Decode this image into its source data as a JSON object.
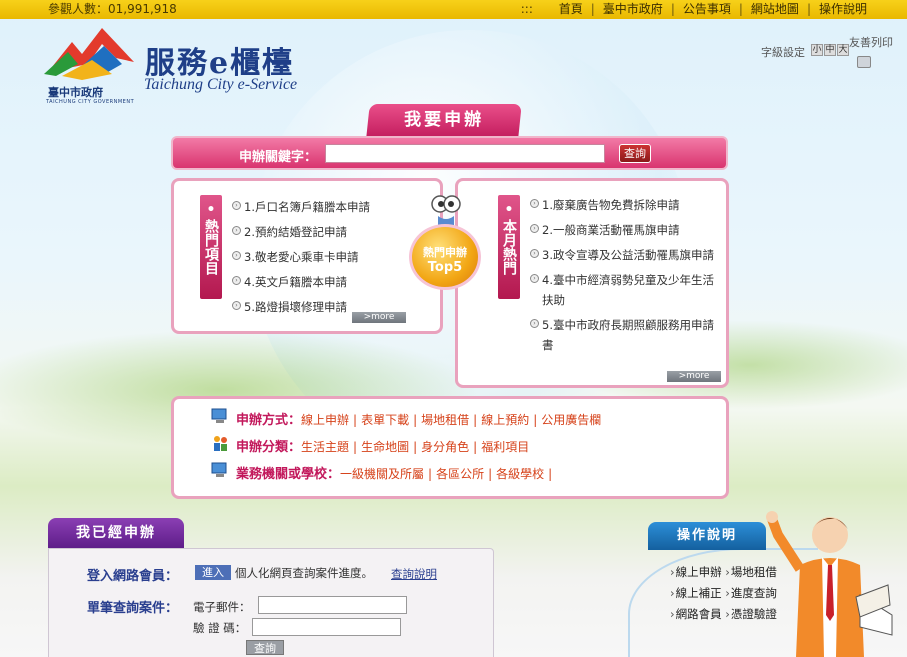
{
  "topbar": {
    "counter_label": "參觀人數：01,991,918",
    "nav_prefix": ":::",
    "nav": [
      "首頁",
      "臺中市政府",
      "公告事項",
      "網站地圖",
      "操作說明"
    ]
  },
  "logo": {
    "emblem_zh": "臺中市政府",
    "emblem_en": "TAICHUNG CITY GOVERNMENT",
    "title": "服務e櫃檯",
    "subtitle": "Taichung City e-Service"
  },
  "tools": {
    "font_label": "字級設定",
    "font_sizes": [
      "小",
      "中",
      "大"
    ],
    "print_label": "友善列印"
  },
  "apply": {
    "tab_label": "我要申辦",
    "search_label": "申辦關鍵字：",
    "search_value": "",
    "search_button": "查詢"
  },
  "hot": {
    "tab_label": "熱門項目",
    "items": [
      "1.戶口名簿戶籍謄本申請",
      "2.預約結婚登記申請",
      "3.敬老愛心乘車卡申請",
      "4.英文戶籍謄本申請",
      "5.路燈損壞修理申請"
    ],
    "more": ">more"
  },
  "monthly": {
    "tab_label": "本月熱門",
    "items": [
      "1.廢棄廣告物免費拆除申請",
      "2.一般商業活動罹馬旗申請",
      "3.政令宣導及公益活動罹馬旗申請",
      "4.臺中市經濟弱勢兒童及少年生活扶助",
      "5.臺中市政府長期照顧服務用申請書"
    ],
    "more": ">more"
  },
  "top5": {
    "line1": "熱門申辦",
    "line2": "Top5"
  },
  "methods": {
    "row1": {
      "head": "申辦方式：",
      "links": [
        "線上申辦",
        "表單下載",
        "場地租借",
        "線上預約",
        "公用廣告欄"
      ]
    },
    "row2": {
      "head": "申辦分類：",
      "links": [
        "生活主題",
        "生命地圖",
        "身分角色",
        "福利項目"
      ]
    },
    "row3": {
      "head": "業務機關或學校：",
      "links": [
        "一級機關及所屬",
        "各區公所",
        "各級學校"
      ]
    }
  },
  "applied": {
    "tab_label": "我已經申辦",
    "member_label": "登入網路會員：",
    "enter_button": "進入",
    "member_desc": "個人化網頁查詢案件進度。",
    "help_link": "查詢說明",
    "single_label": "單筆查詢案件：",
    "email_label": "電子郵件：",
    "email_value": "",
    "code_label": "驗 證 碼：",
    "code_value": "",
    "query_button": "查詢"
  },
  "guide": {
    "tab_label": "操作說明",
    "rows": [
      [
        "線上申辦",
        "場地租借"
      ],
      [
        "線上補正",
        "進度查詢"
      ],
      [
        "網路會員",
        "憑證驗證"
      ]
    ]
  },
  "colors": {
    "topbar": "#f2c60c",
    "pink_accent": "#d9346f",
    "purple_tab": "#6e2a9c",
    "blue_tab": "#1c74bd",
    "link_orange": "#d6421a"
  }
}
